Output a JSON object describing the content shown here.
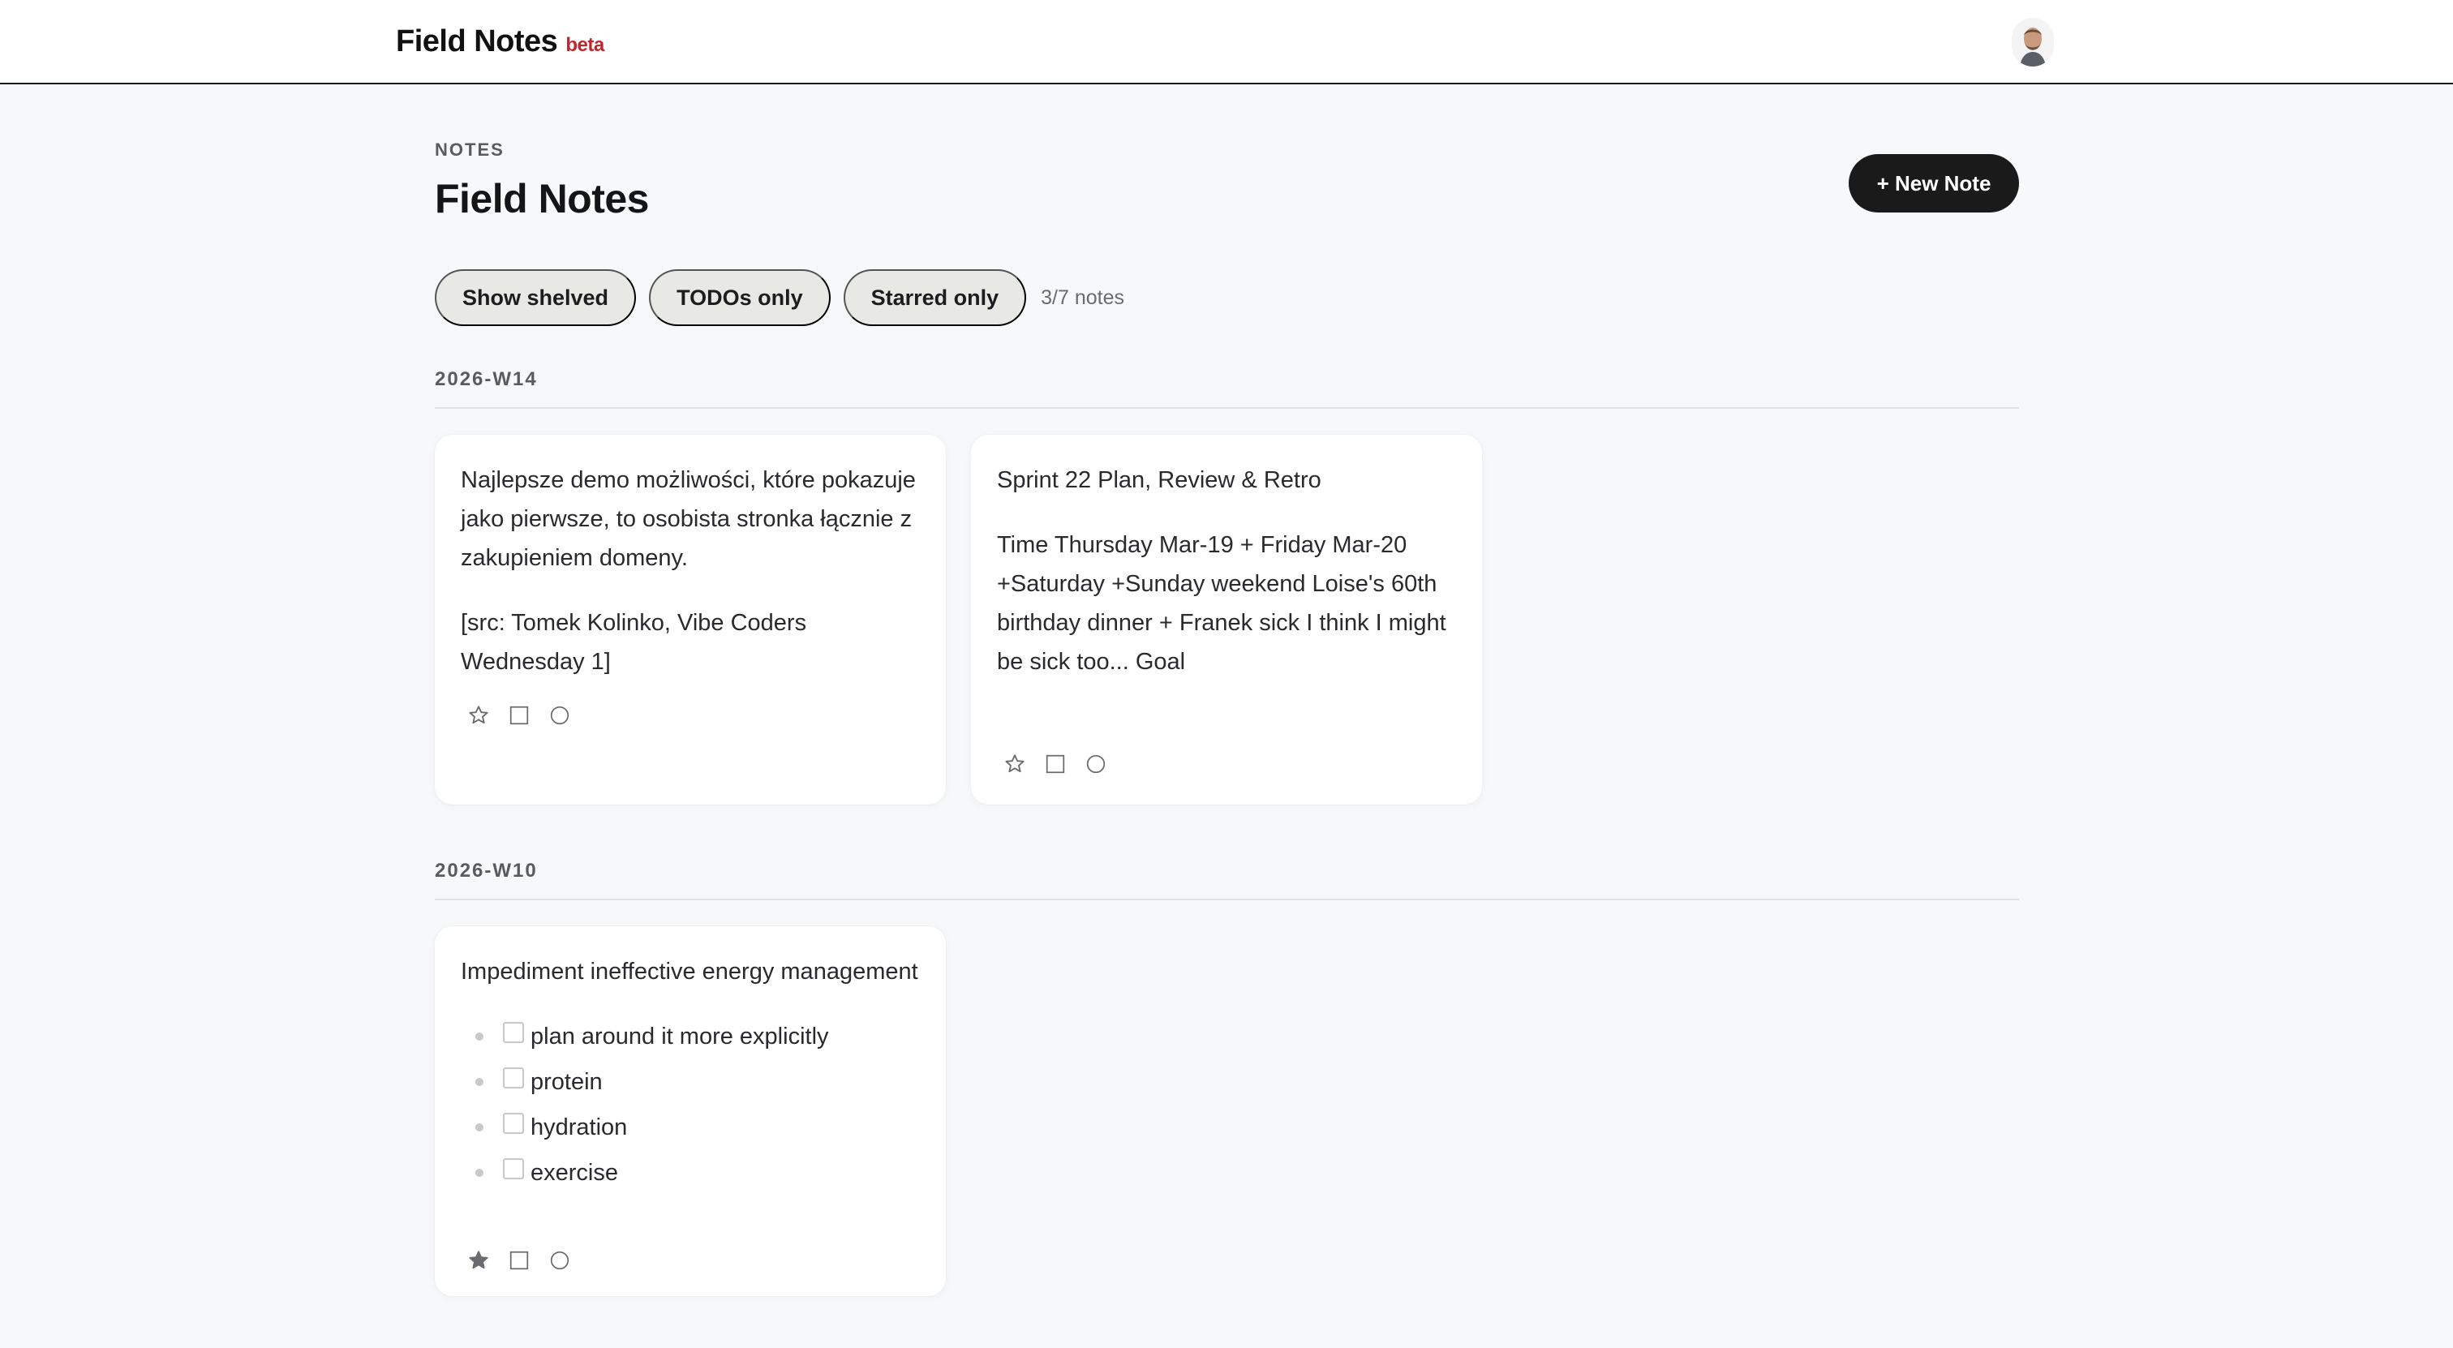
{
  "app": {
    "title": "Field Notes",
    "badge": "beta",
    "beta_color": "#c0262d"
  },
  "page": {
    "eyebrow": "NOTES",
    "title": "Field Notes",
    "new_note_label": "+ New Note"
  },
  "filters": {
    "show_shelved": "Show shelved",
    "todos_only": "TODOs only",
    "starred_only": "Starred only",
    "count": "3/7 notes"
  },
  "weeks": [
    {
      "label": "2026-W14",
      "notes": [
        {
          "paragraphs": [
            "Najlepsze demo możliwości, które pokazuje jako pierwsze, to osobista stronka łącznie z zakupieniem domeny.",
            "[src: Tomek Kolinko, Vibe Coders Wednesday 1]"
          ],
          "starred": false
        },
        {
          "paragraphs": [
            "Sprint 22 Plan, Review & Retro",
            "Time Thursday Mar-19 + Friday Mar-20 +Saturday +Sunday weekend Loise's 60th birthday dinner + Franek sick I think I might be sick too... Goal"
          ],
          "starred": false
        }
      ]
    },
    {
      "label": "2026-W10",
      "notes": [
        {
          "title": "Impediment ineffective energy management",
          "checklist": [
            "plan around it more explicitly",
            "protein",
            "hydration",
            "exercise"
          ],
          "starred": true
        }
      ]
    }
  ],
  "icons": {
    "star": "star-icon",
    "square": "square-icon",
    "circle": "circle-icon"
  }
}
